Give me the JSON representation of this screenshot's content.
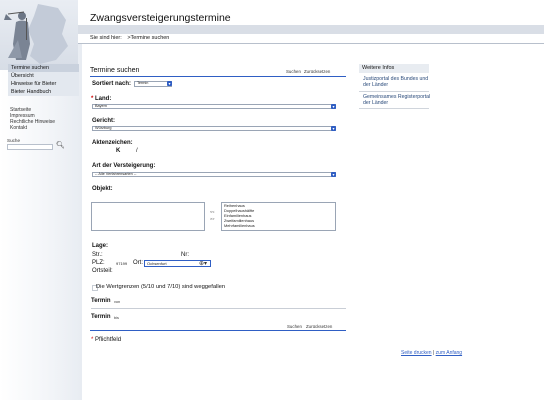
{
  "header": {
    "title": "Zwangsversteigerungstermine",
    "breadcrumb_prefix": "Sie sind hier:",
    "breadcrumb_current": ">Termine suchen"
  },
  "sidebar": {
    "nav": [
      {
        "label": "Termine suchen",
        "selected": true
      },
      {
        "label": "Übersicht",
        "selected": false
      },
      {
        "label": "Hinweise für Bieter",
        "selected": false
      },
      {
        "label": "Bieter Handbuch",
        "selected": false
      }
    ],
    "links": [
      "Startseite",
      "Impressum",
      "Rechtliche Hinweise",
      "Kontakt"
    ],
    "search_label": "Suche",
    "search_value": ""
  },
  "form": {
    "heading": "Termine suchen",
    "top_actions": {
      "search": "Suchen",
      "reset": "Zurücksetzen"
    },
    "sort_label": "Sortiert nach:",
    "sort_value": "Termin",
    "land_label": "Land:",
    "land_value": "Bayern",
    "gericht_label": "Gericht:",
    "gericht_value": "Würzburg",
    "aktenzeichen_label": "Aktenzeichen:",
    "aktenzeichen_k": "K",
    "aktenzeichen_slash": "/",
    "versteigerung_label": "Art der Versteigerung:",
    "versteigerung_value": "-- Alle Verfahrensarten --",
    "objekt_label": "Objekt:",
    "move_right": "<<",
    "move_left": ">>",
    "objekt_options": [
      "Reihenhaus",
      "Doppelhaushälfte",
      "Einfamilienhaus",
      "Zweifamilienhaus",
      "Mehrfamilienhaus"
    ],
    "lage_label": "Lage:",
    "str_label": "Str.:",
    "nr_label": "Nr:",
    "plz_label": "PLZ:",
    "plz_value": "97199",
    "ort_label": "Ort:",
    "ort_value": "Ochsenfurt",
    "ortsteil_label": "Ortsteil:",
    "checkbox_label": "Die Wertgrenzen (5/10 und 7/10) sind weggefallen",
    "termin_label": "Termin",
    "termin_von": "von",
    "termin_bis": "bis",
    "bottom_actions": {
      "search": "Suchen",
      "reset": "Zurücksetzen"
    },
    "required_note": "Pflichtfeld"
  },
  "info": {
    "heading": "Weitere Infos",
    "links": [
      "Justizportal des Bundes und der Länder",
      "Gemeinsames Registerportal der Länder"
    ]
  },
  "footer": {
    "print": "Seite drucken",
    "top": "zum Anfang"
  },
  "colors": {
    "accent": "#2f5ec4",
    "required": "#cc0000",
    "nav_selected": "#c9d1dd"
  }
}
